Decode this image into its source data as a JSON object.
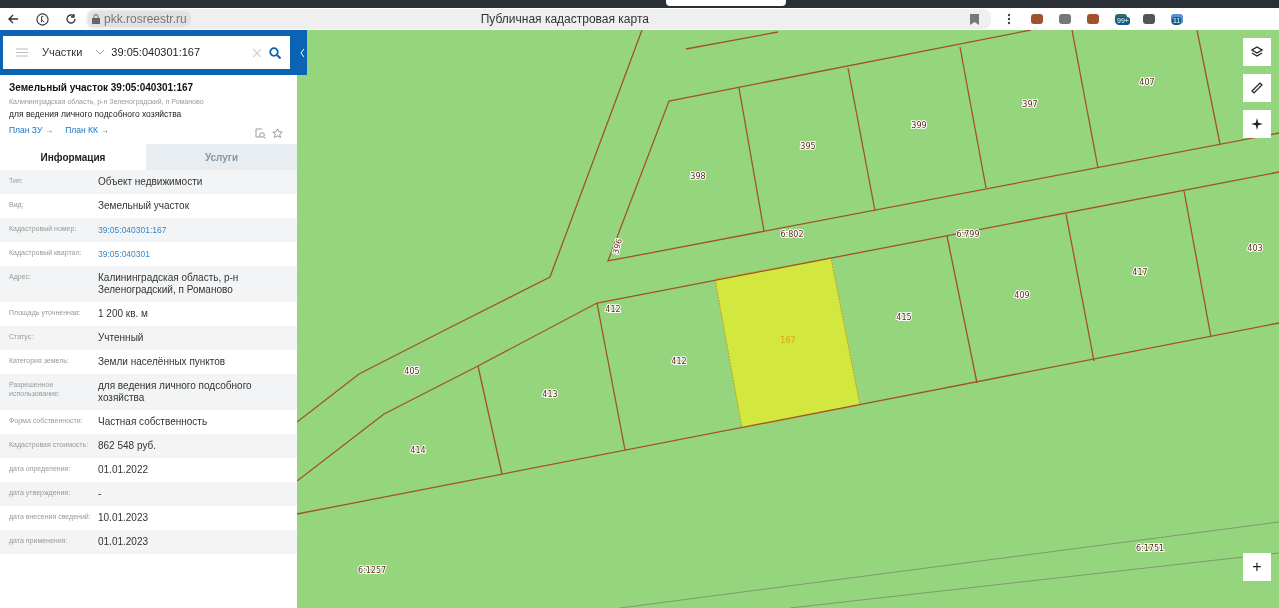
{
  "browser": {
    "url": "pkk.rosreestr.ru",
    "title": "Публичная кадастровая карта",
    "extension_badges": [
      "99+",
      "11"
    ]
  },
  "search": {
    "category": "Участки",
    "value": "39:05:040301:167"
  },
  "object": {
    "title": "Земельный участок 39:05:040301:167",
    "address": "Калининградская область, р-н Зеленоградский, п Романово",
    "purpose": "для ведения личного подсобного хозяйства",
    "links": [
      "План ЗУ →",
      "План КК →"
    ]
  },
  "tabs": [
    {
      "label": "Информация",
      "selected": true
    },
    {
      "label": "Услуги",
      "selected": false
    }
  ],
  "rows": [
    {
      "label": "Тип:",
      "value": "Объект недвижимости",
      "kind": "text"
    },
    {
      "label": "Вид:",
      "value": "Земельный участок",
      "kind": "text"
    },
    {
      "label": "Кадастровый номер:",
      "value": "39:05:040301:167",
      "kind": "link"
    },
    {
      "label": "Кадастровый квартал:",
      "value": "39:05:040301",
      "kind": "link"
    },
    {
      "label": "Адрес:",
      "value": "Калининградская область, р-н Зеленоградский, п Романово",
      "kind": "text"
    },
    {
      "label": "Площадь уточненная:",
      "value": "1 200 кв. м",
      "kind": "text"
    },
    {
      "label": "Статус:",
      "value": "Учтенный",
      "kind": "text"
    },
    {
      "label": "Категория земель:",
      "value": "Земли населённых пунктов",
      "kind": "text"
    },
    {
      "label": "Разрешенное использование:",
      "value": "для ведения личного подсобного хозяйства",
      "kind": "text"
    },
    {
      "label": "Форма собственности:",
      "value": "Частная собственность",
      "kind": "text"
    },
    {
      "label": "Кадастровая стоимость:",
      "value": "862 548 руб.",
      "kind": "text"
    },
    {
      "label": "дата определения:",
      "value": "01.01.2022",
      "kind": "text"
    },
    {
      "label": "дата утверждения:",
      "value": "-",
      "kind": "text"
    },
    {
      "label": "дата внесения сведений:",
      "value": "10.01.2023",
      "kind": "text"
    },
    {
      "label": "дата применения:",
      "value": "01.01.2023",
      "kind": "text"
    }
  ],
  "map": {
    "labels": [
      {
        "text": "398",
        "selected": false
      },
      {
        "text": "395",
        "selected": false
      },
      {
        "text": "399",
        "selected": false
      },
      {
        "text": "397",
        "selected": false
      },
      {
        "text": "407",
        "selected": false
      },
      {
        "text": "396",
        "selected": false
      },
      {
        "text": "6:802",
        "selected": false
      },
      {
        "text": "6:799",
        "selected": false
      },
      {
        "text": "403",
        "selected": false
      },
      {
        "text": "417",
        "selected": false
      },
      {
        "text": "409",
        "selected": false
      },
      {
        "text": "415",
        "selected": false
      },
      {
        "text": "412",
        "selected": false
      },
      {
        "text": "412",
        "selected": false
      },
      {
        "text": "167",
        "selected": true
      },
      {
        "text": "405",
        "selected": false
      },
      {
        "text": "413",
        "selected": false
      },
      {
        "text": "414",
        "selected": false
      },
      {
        "text": "6:1751",
        "selected": false
      },
      {
        "text": "6:1257",
        "selected": false
      }
    ],
    "zoom_in": "+"
  }
}
